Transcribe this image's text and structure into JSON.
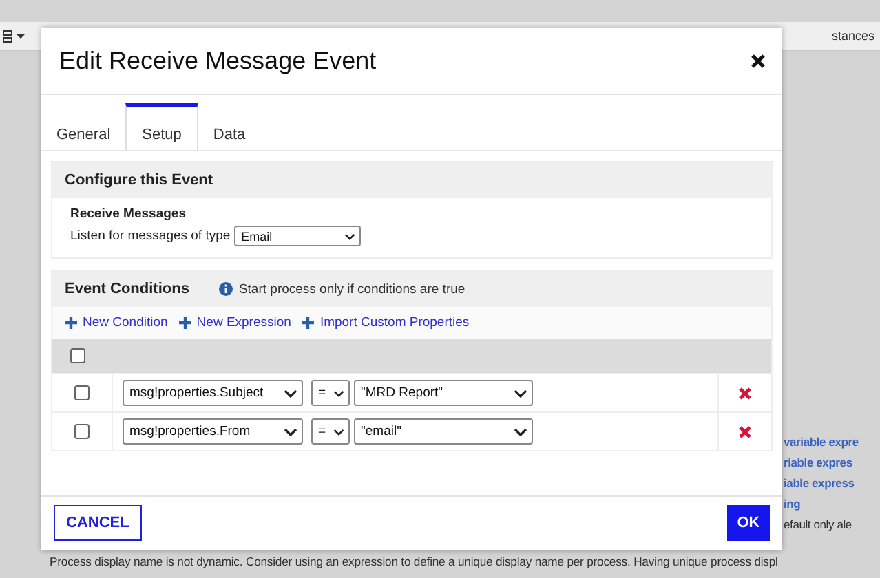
{
  "background": {
    "toolbar_text": "stances",
    "side_items": [
      {
        "kind": "link",
        "text": "variable expre"
      },
      {
        "kind": "link",
        "text": "riable expres"
      },
      {
        "kind": "link",
        "text": "iable express"
      },
      {
        "kind": "link",
        "text": "ing"
      },
      {
        "kind": "note",
        "text": "efault only ale"
      }
    ],
    "notice": "Process display name is not dynamic. Consider using an expression to define a unique display name per process. Having unique process displ"
  },
  "dialog": {
    "title": "Edit Receive Message Event",
    "tabs": [
      {
        "label": "General",
        "selected": false
      },
      {
        "label": "Setup",
        "selected": true
      },
      {
        "label": "Data",
        "selected": false
      }
    ],
    "configure": {
      "heading": "Configure this Event",
      "subheading": "Receive Messages",
      "label": "Listen for messages of type",
      "message_type": "Email"
    },
    "conditions": {
      "heading": "Event Conditions",
      "info": "Start process only if conditions are true",
      "actions": [
        "New Condition",
        "New Expression",
        "Import Custom Properties"
      ],
      "header_checked": false,
      "rows": [
        {
          "checked": false,
          "property": "msg!properties.Subject",
          "operator": "=",
          "value": "\"MRD Report\""
        },
        {
          "checked": false,
          "property": "msg!properties.From",
          "operator": "=",
          "value": "\"email\""
        }
      ]
    },
    "buttons": {
      "cancel": "CANCEL",
      "ok": "OK"
    }
  }
}
